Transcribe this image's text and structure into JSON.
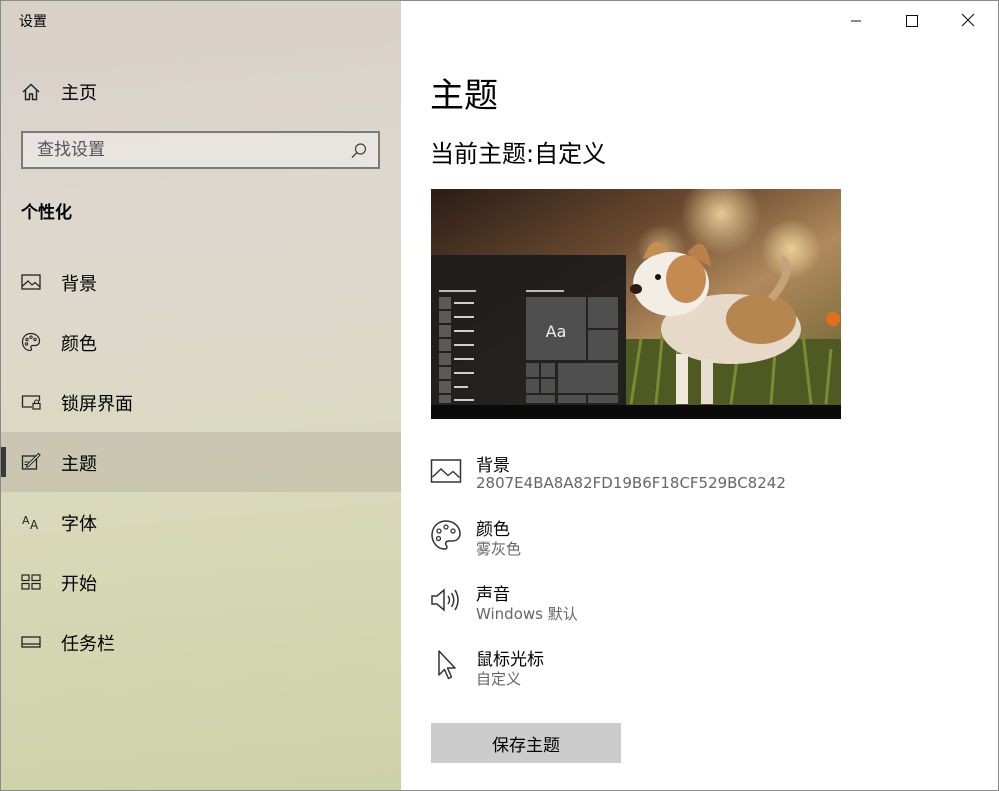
{
  "app": {
    "title": "设置"
  },
  "sidebar": {
    "home_label": "主页",
    "search_placeholder": "查找设置",
    "section_heading": "个性化",
    "items": [
      {
        "label": "背景",
        "icon": "picture-icon"
      },
      {
        "label": "颜色",
        "icon": "palette-icon"
      },
      {
        "label": "锁屏界面",
        "icon": "lock-screen-icon"
      },
      {
        "label": "主题",
        "icon": "theme-icon",
        "selected": true
      },
      {
        "label": "字体",
        "icon": "font-icon"
      },
      {
        "label": "开始",
        "icon": "start-icon"
      },
      {
        "label": "任务栏",
        "icon": "taskbar-icon"
      }
    ]
  },
  "main": {
    "title": "主题",
    "current_theme": "当前主题:自定义",
    "preview_sample_text": "Aa",
    "settings": [
      {
        "label": "背景",
        "value": "2807E4BA8A82FD19B6F18CF529BC8242",
        "icon": "picture-icon"
      },
      {
        "label": "颜色",
        "value": "雾灰色",
        "icon": "palette-icon"
      },
      {
        "label": "声音",
        "value": "Windows 默认",
        "icon": "speaker-icon"
      },
      {
        "label": "鼠标光标",
        "value": "自定义",
        "icon": "cursor-icon"
      }
    ],
    "save_button_label": "保存主题"
  },
  "colors": {
    "accent_selected_bar": "#3a3a3a",
    "button_bg": "#cccccc",
    "secondary_text": "#666666"
  }
}
